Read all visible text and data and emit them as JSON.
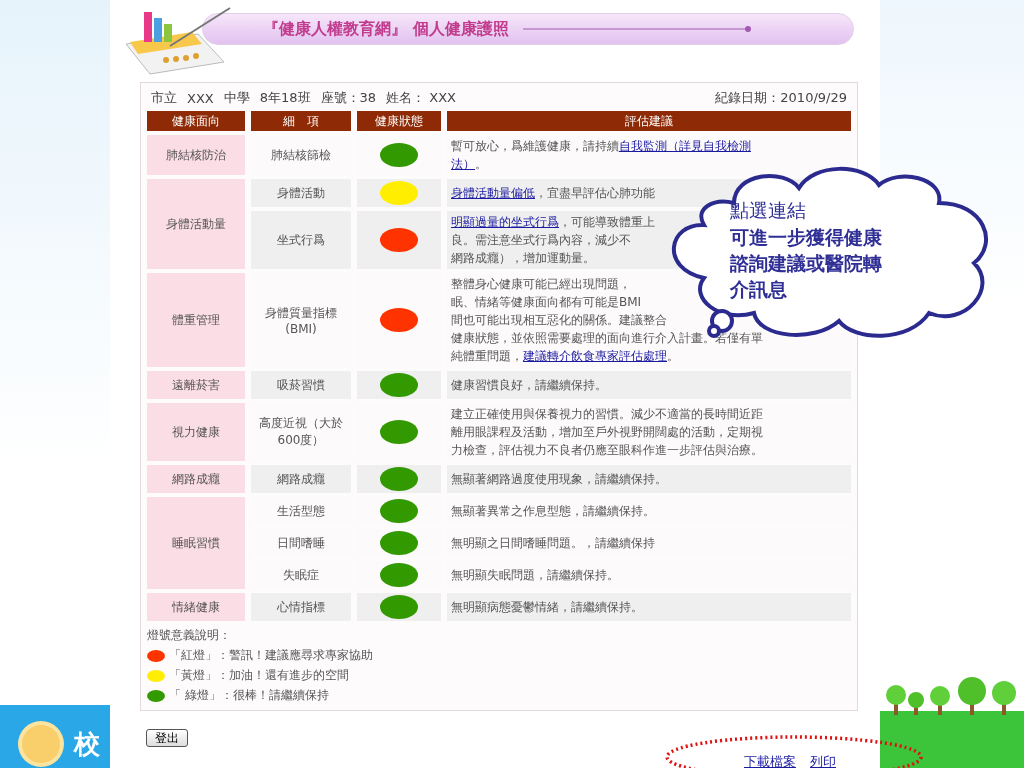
{
  "banner": {
    "title": "『健康人權教育網』 個人健康護照"
  },
  "info": {
    "fields": [
      "市立",
      "XXX",
      "中學",
      "8年18班",
      "座號：38",
      "姓名： XXX"
    ],
    "date": "紀錄日期：2010/9/29"
  },
  "table": {
    "columns": [
      "健康面向",
      "細　項",
      "健康狀態",
      "評估建議"
    ],
    "groups": [
      {
        "category": "肺結核防治",
        "items": [
          {
            "detail": "肺結核篩檢",
            "color": "#339900",
            "lines": [
              [
                {
                  "text": "暫可放心，爲維護健康，請持續",
                  "link": false
                },
                {
                  "text": "自我監測（詳見自我檢測",
                  "link": true
                }
              ],
              [
                {
                  "text": "法）",
                  "link": true
                },
                {
                  "text": "。",
                  "link": false
                }
              ]
            ]
          }
        ]
      },
      {
        "category": "身體活動量",
        "items": [
          {
            "detail": "身體活動",
            "color": "#ffee00",
            "lines": [
              [
                {
                  "text": "身體活動量偏低",
                  "link": true
                },
                {
                  "text": "，宜盡早評估心肺功能",
                  "link": false
                }
              ]
            ]
          },
          {
            "detail": "坐式行爲",
            "color": "#ff3300",
            "lines": [
              [
                {
                  "text": "明顯過量的坐式行爲",
                  "link": true
                },
                {
                  "text": "，可能導致體重上",
                  "link": false
                }
              ],
              [
                {
                  "text": "良。需注意坐式行爲內容，減少不",
                  "link": false
                }
              ],
              [
                {
                  "text": "網路成癮），增加運動量。",
                  "link": false
                }
              ]
            ]
          }
        ]
      },
      {
        "category": "體重管理",
        "items": [
          {
            "detail": "身體質量指標(BMI)",
            "color": "#ff3300",
            "lines": [
              [
                {
                  "text": "整體身心健康可能已經出現問題，",
                  "link": false
                }
              ],
              [
                {
                  "text": "眠、情緒等健康面向都有可能是BMI",
                  "link": false
                }
              ],
              [
                {
                  "text": "間也可能出現相互惡化的關係。建議整合",
                  "link": false
                }
              ],
              [
                {
                  "text": "健康狀態，並依照需要處理的面向進行介入計畫。若僅有單",
                  "link": false
                }
              ],
              [
                {
                  "text": "純體重問題，",
                  "link": false
                },
                {
                  "text": "建議轉介飲食專家評估處理",
                  "link": true
                },
                {
                  "text": "。",
                  "link": false
                }
              ]
            ]
          }
        ]
      },
      {
        "category": "遠離菸害",
        "items": [
          {
            "detail": "吸菸習慣",
            "color": "#339900",
            "lines": [
              [
                {
                  "text": "健康習慣良好，請繼續保持。",
                  "link": false
                }
              ]
            ]
          }
        ]
      },
      {
        "category": "視力健康",
        "items": [
          {
            "detail": "高度近視（大於600度）",
            "color": "#339900",
            "lines": [
              [
                {
                  "text": "建立正確使用與保養視力的習慣。減少不適當的長時間近距",
                  "link": false
                }
              ],
              [
                {
                  "text": "離用眼課程及活動，增加至戶外視野開闊處的活動，定期視",
                  "link": false
                }
              ],
              [
                {
                  "text": "力檢查，評估視力不良者仍應至眼科作進一步評估與治療。",
                  "link": false
                }
              ]
            ]
          }
        ]
      },
      {
        "category": "網路成癮",
        "items": [
          {
            "detail": "網路成癮",
            "color": "#339900",
            "lines": [
              [
                {
                  "text": "無顯著網路過度使用現象，請繼續保持。",
                  "link": false
                }
              ]
            ]
          }
        ]
      },
      {
        "category": "睡眠習慣",
        "items": [
          {
            "detail": "生活型態",
            "color": "#339900",
            "lines": [
              [
                {
                  "text": "無顯著異常之作息型態，請繼續保持。",
                  "link": false
                }
              ]
            ]
          },
          {
            "detail": "日間嗜睡",
            "color": "#339900",
            "lines": [
              [
                {
                  "text": "無明顯之日間嗜睡問題。，請繼續保持",
                  "link": false
                }
              ]
            ]
          },
          {
            "detail": "失眠症",
            "color": "#339900",
            "lines": [
              [
                {
                  "text": "無明顯失眠問題，請繼續保持。",
                  "link": false
                }
              ]
            ]
          }
        ]
      },
      {
        "category": "情緒健康",
        "items": [
          {
            "detail": "心情指標",
            "color": "#339900",
            "lines": [
              [
                {
                  "text": "無明顯病態憂鬱情緒，請繼續保持。",
                  "link": false
                }
              ]
            ]
          }
        ]
      }
    ]
  },
  "legend": {
    "title": "燈號意義說明：",
    "entries": [
      {
        "color": "#ff3300",
        "text": "「紅燈」：警訊！建議應尋求專家協助"
      },
      {
        "color": "#ffee00",
        "text": "「黃燈」：加油！還有進步的空間"
      },
      {
        "color": "#339900",
        "text": "「 綠燈」：很棒！請繼續保持"
      }
    ]
  },
  "logout_button": "登出",
  "links": [
    "下載檔案",
    "列印"
  ],
  "callout": {
    "title": "點選連結",
    "body": "可進一步獲得健康諮詢建議或醫院轉介訊息"
  },
  "logo": {
    "text": "校"
  }
}
